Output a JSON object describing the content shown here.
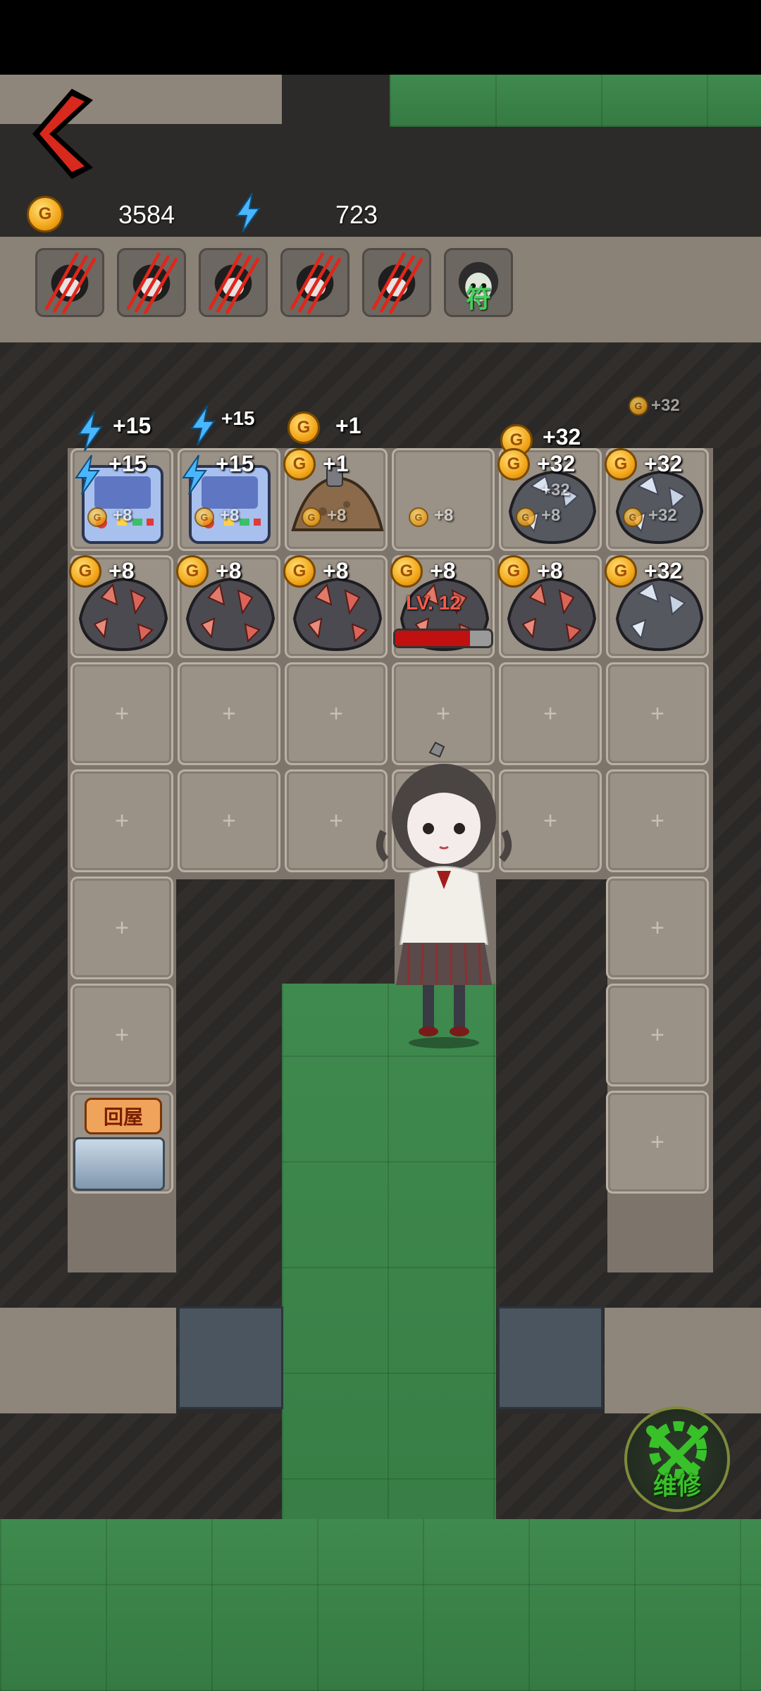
{
  "hud": {
    "gold_value": "3584",
    "energy_value": "723",
    "coin_letter": "G",
    "back_icon": "chevron-left-icon"
  },
  "top_slots": [
    {
      "icon": "scratched-portrait-icon"
    },
    {
      "icon": "scratched-portrait-icon"
    },
    {
      "icon": "scratched-portrait-icon"
    },
    {
      "icon": "scratched-portrait-icon"
    },
    {
      "icon": "scratched-portrait-icon"
    },
    {
      "icon": "ghost-girl-icon",
      "badge": "符"
    },
    {
      "icon": "empty-slot"
    }
  ],
  "floating": {
    "energy_a": "+15",
    "energy_b": "+15",
    "gold_c": "+1",
    "gold_d": "+32",
    "gold_e_small": "+32"
  },
  "grid": {
    "row1": [
      {
        "type": "arcade-machine",
        "yield": "+15",
        "sub": "+8"
      },
      {
        "type": "arcade-machine",
        "yield": "+15",
        "sub": "+8"
      },
      {
        "type": "dirt-mound",
        "yield": "+1",
        "sub": "+8"
      },
      {
        "type": "empty",
        "sub": "+8"
      },
      {
        "type": "silver-ore",
        "yield": "+32",
        "sub": "+8",
        "faint": "+32"
      },
      {
        "type": "silver-ore",
        "yield": "+32",
        "sub": "+32"
      }
    ],
    "row2": [
      {
        "type": "red-ore",
        "yield": "+8"
      },
      {
        "type": "red-ore",
        "yield": "+8"
      },
      {
        "type": "red-ore",
        "yield": "+8"
      },
      {
        "type": "red-ore",
        "yield": "+8",
        "level": "LV. 12",
        "hp": 0.78
      },
      {
        "type": "red-ore",
        "yield": "+8"
      },
      {
        "type": "silver-ore",
        "yield": "+32"
      }
    ]
  },
  "return_button": "回屋",
  "repair_button": "维修",
  "plus_glyph": "+",
  "colors": {
    "accent_red": "#d8291d",
    "coin_gold": "#f2a61a",
    "energy_blue": "#49b6ff",
    "hp_red": "#c01010",
    "grass_green": "#3f8a4e",
    "repair_green": "#39c12a"
  }
}
